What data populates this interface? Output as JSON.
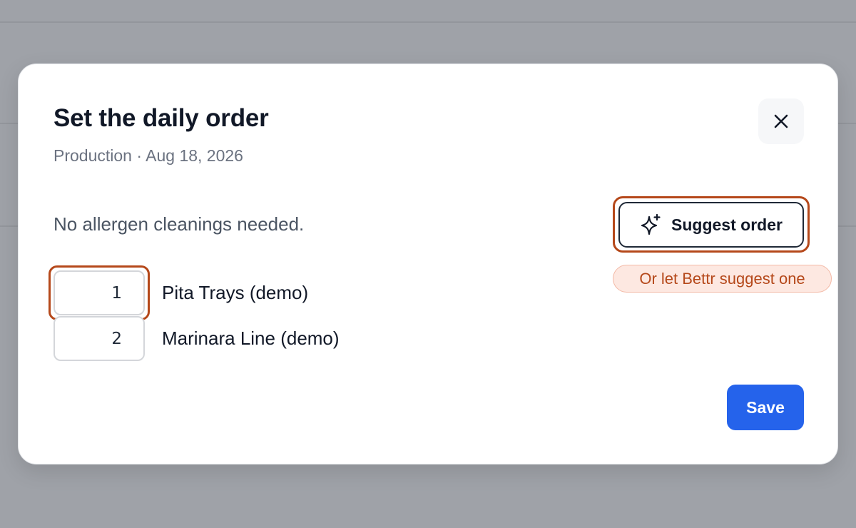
{
  "modal": {
    "title": "Set the daily order",
    "subtitle": "Production · Aug 18, 2026",
    "close_icon": "close-icon"
  },
  "allergen_status": "No allergen cleanings needed.",
  "suggest": {
    "label": "Suggest order",
    "icon": "sparkles-icon",
    "hint": "Or let Bettr suggest one",
    "highlight_color": "#b5481a"
  },
  "items": [
    {
      "order": "1",
      "name": "Pita Trays (demo)"
    },
    {
      "order": "2",
      "name": "Marinara Line (demo)"
    }
  ],
  "save_label": "Save",
  "colors": {
    "primary": "#2563eb",
    "highlight": "#b5481a",
    "hint_background": "#fde8e1"
  }
}
